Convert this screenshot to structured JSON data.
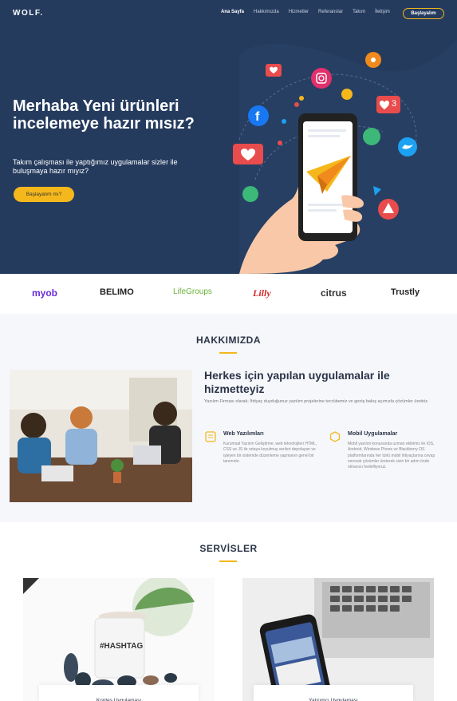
{
  "nav": {
    "logo": "WOLF.",
    "items": [
      "Ana Sayfa",
      "Hakkımızda",
      "Hizmetler",
      "Referanslar",
      "Takım",
      "İletişim"
    ],
    "cta": "Başlayalım"
  },
  "hero": {
    "title": "Merhaba Yeni ürünleri incelemeye hazır mısız?",
    "subtitle": "Takım çalışması ile yaptığımız uygulamalar sizler ile buluşmaya hazır mıyız?",
    "button": "Başlayalım mı?",
    "badge_count": "3"
  },
  "brands": [
    "myob",
    "BELIMO",
    "LifeGroups",
    "Lilly",
    "citrus",
    "Trustly"
  ],
  "about": {
    "section_title": "HAKKIMIZDA",
    "heading": "Herkes için yapılan uygulamalar ile hizmetteyiz",
    "text": "Yazılım Firması olarak; İhtiyaç duyduğunuz yazılım projelerine tecrübemiz ve geniş bakış açımızla çözümler üretiriz.",
    "features": [
      {
        "title": "Web Yazılımları",
        "text": "Kurumsal Yazılım Geliştirme, web teknolojileri HTML, CSS ve JS ile ortaya koyulmuş verileri depolayan ve işleyen bir sistemde düzenleme yapmanın genel bir tanımıdır."
      },
      {
        "title": "Mobil Uygulamalar",
        "text": "Mobil yazılım konusunda uzman ekibimiz ile iOS, Android, Windows Phone ve Blackberry OS platformlarında her türlü mobil ihtiyaçlarına cevap verecek çözümler üreterek sizin bir adım önde olmanızı hedefliyoruz."
      }
    ]
  },
  "services": {
    "section_title": "SERVİSLER",
    "cards": [
      "Kontes Uygulaması",
      "Yatırımcı Uygulaması"
    ]
  },
  "colors": {
    "hero_bg": "#253b5e",
    "accent": "#f5b81c"
  }
}
